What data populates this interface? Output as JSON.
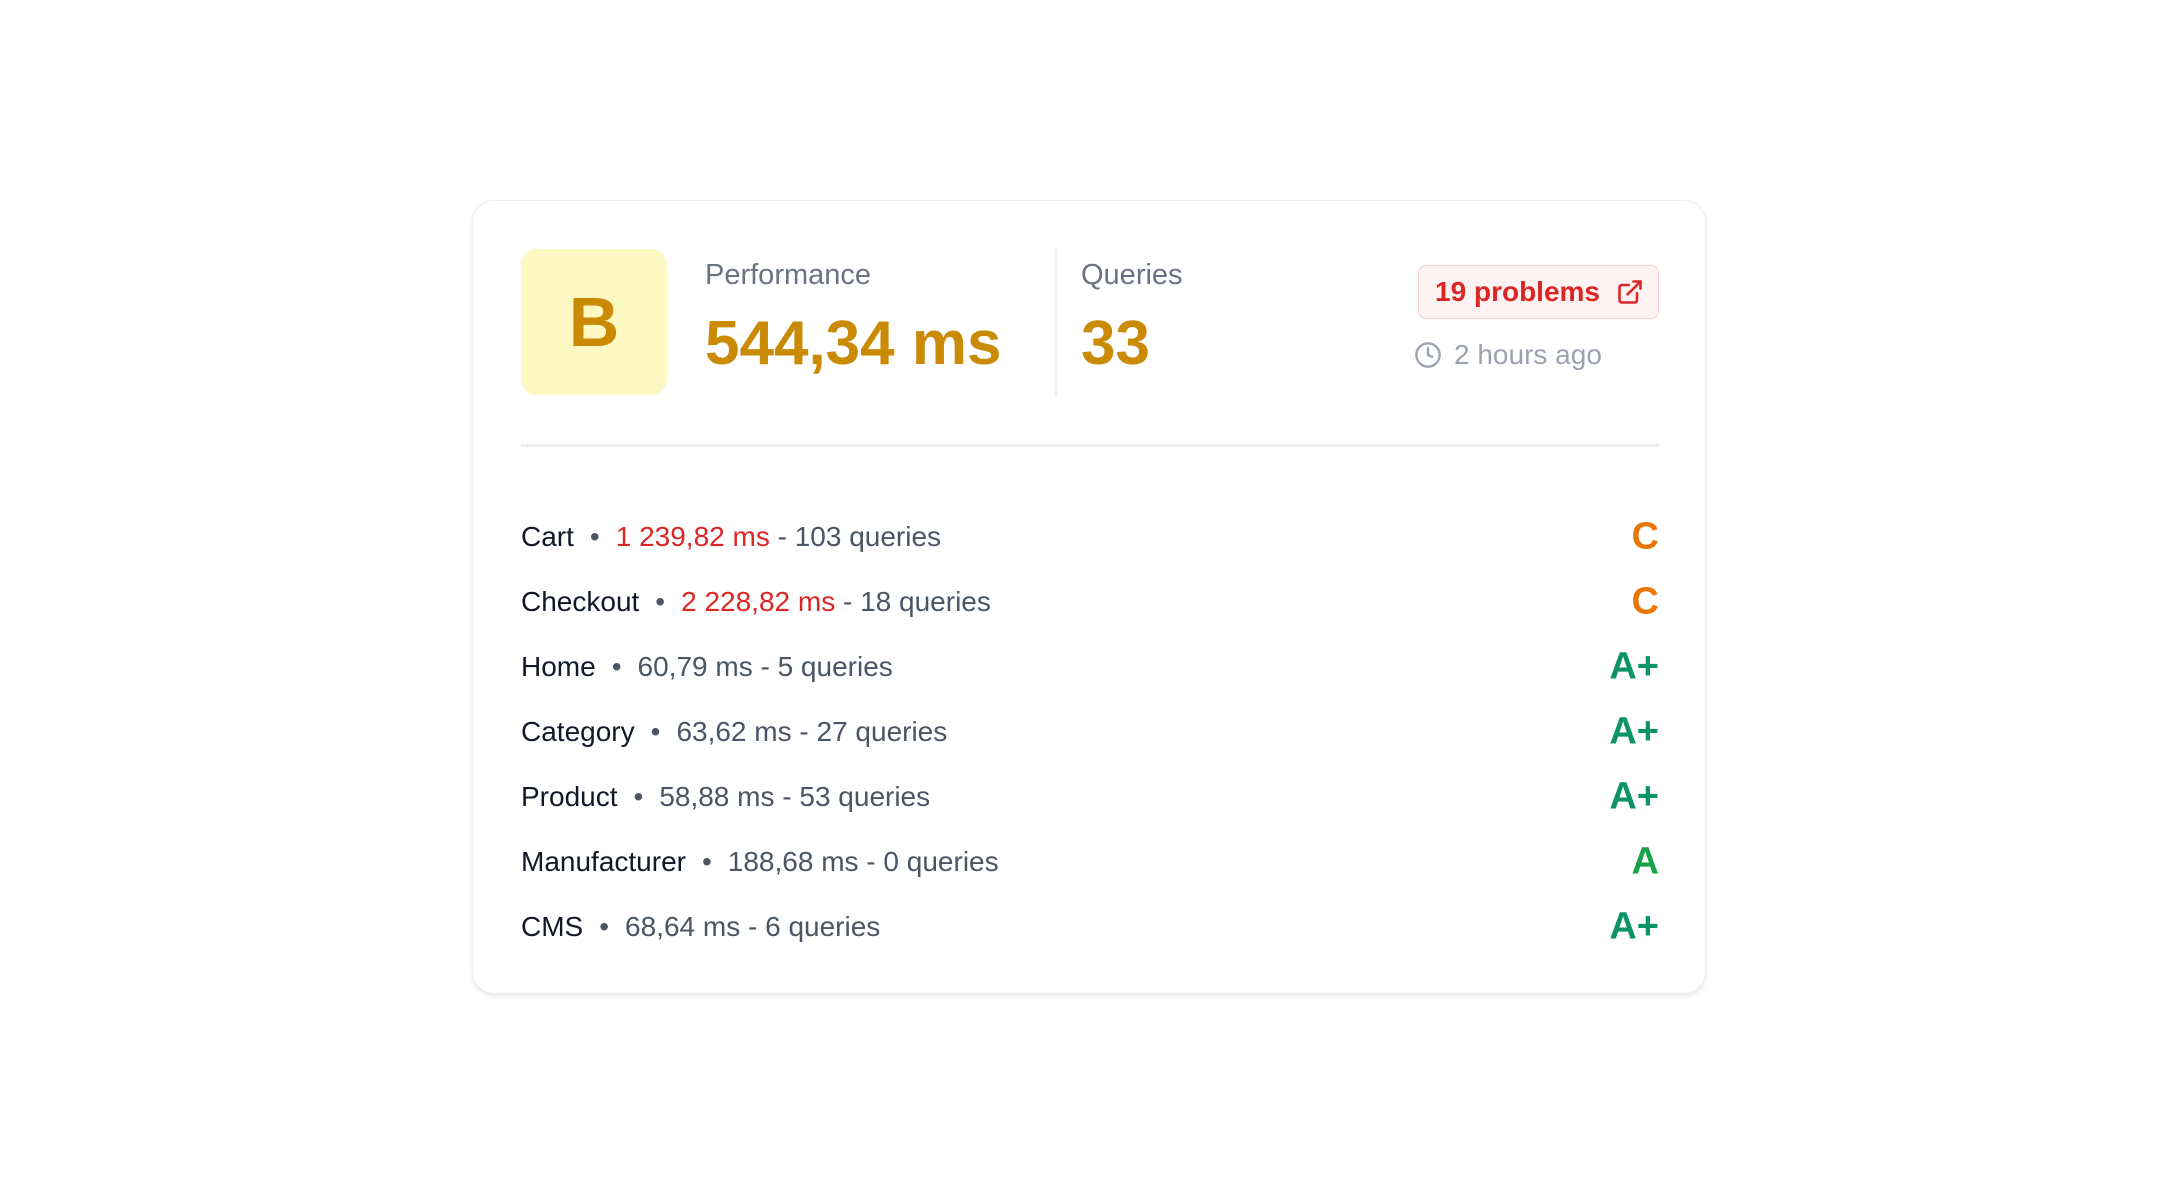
{
  "summary": {
    "grade": "B",
    "performance_label": "Performance",
    "performance_value": "544,34 ms",
    "queries_label": "Queries",
    "queries_value": "33",
    "problems_label": "19 problems",
    "updated": "2 hours ago"
  },
  "colors": {
    "grade_b": "#ca8a04",
    "grade_b_bg": "#fef9c3",
    "grade_c": "#ea7608",
    "grade_a": "#16a34a",
    "grade_a_plus": "#0c9467",
    "error": "#dc2626"
  },
  "icons": {
    "problems": "external-link-icon",
    "updated": "clock-icon"
  },
  "routes": [
    {
      "name": "Cart",
      "ms": "1 239,82 ms",
      "queries": "103 queries",
      "grade": "C",
      "slow": true
    },
    {
      "name": "Checkout",
      "ms": "2 228,82 ms",
      "queries": "18 queries",
      "grade": "C",
      "slow": true
    },
    {
      "name": "Home",
      "ms": "60,79 ms",
      "queries": "5 queries",
      "grade": "A+",
      "slow": false
    },
    {
      "name": "Category",
      "ms": "63,62 ms",
      "queries": "27 queries",
      "grade": "A+",
      "slow": false
    },
    {
      "name": "Product",
      "ms": "58,88 ms",
      "queries": "53 queries",
      "grade": "A+",
      "slow": false
    },
    {
      "name": "Manufacturer",
      "ms": "188,68 ms",
      "queries": "0 queries",
      "grade": "A",
      "slow": false
    },
    {
      "name": "CMS",
      "ms": "68,64 ms",
      "queries": "6 queries",
      "grade": "A+",
      "slow": false
    }
  ]
}
